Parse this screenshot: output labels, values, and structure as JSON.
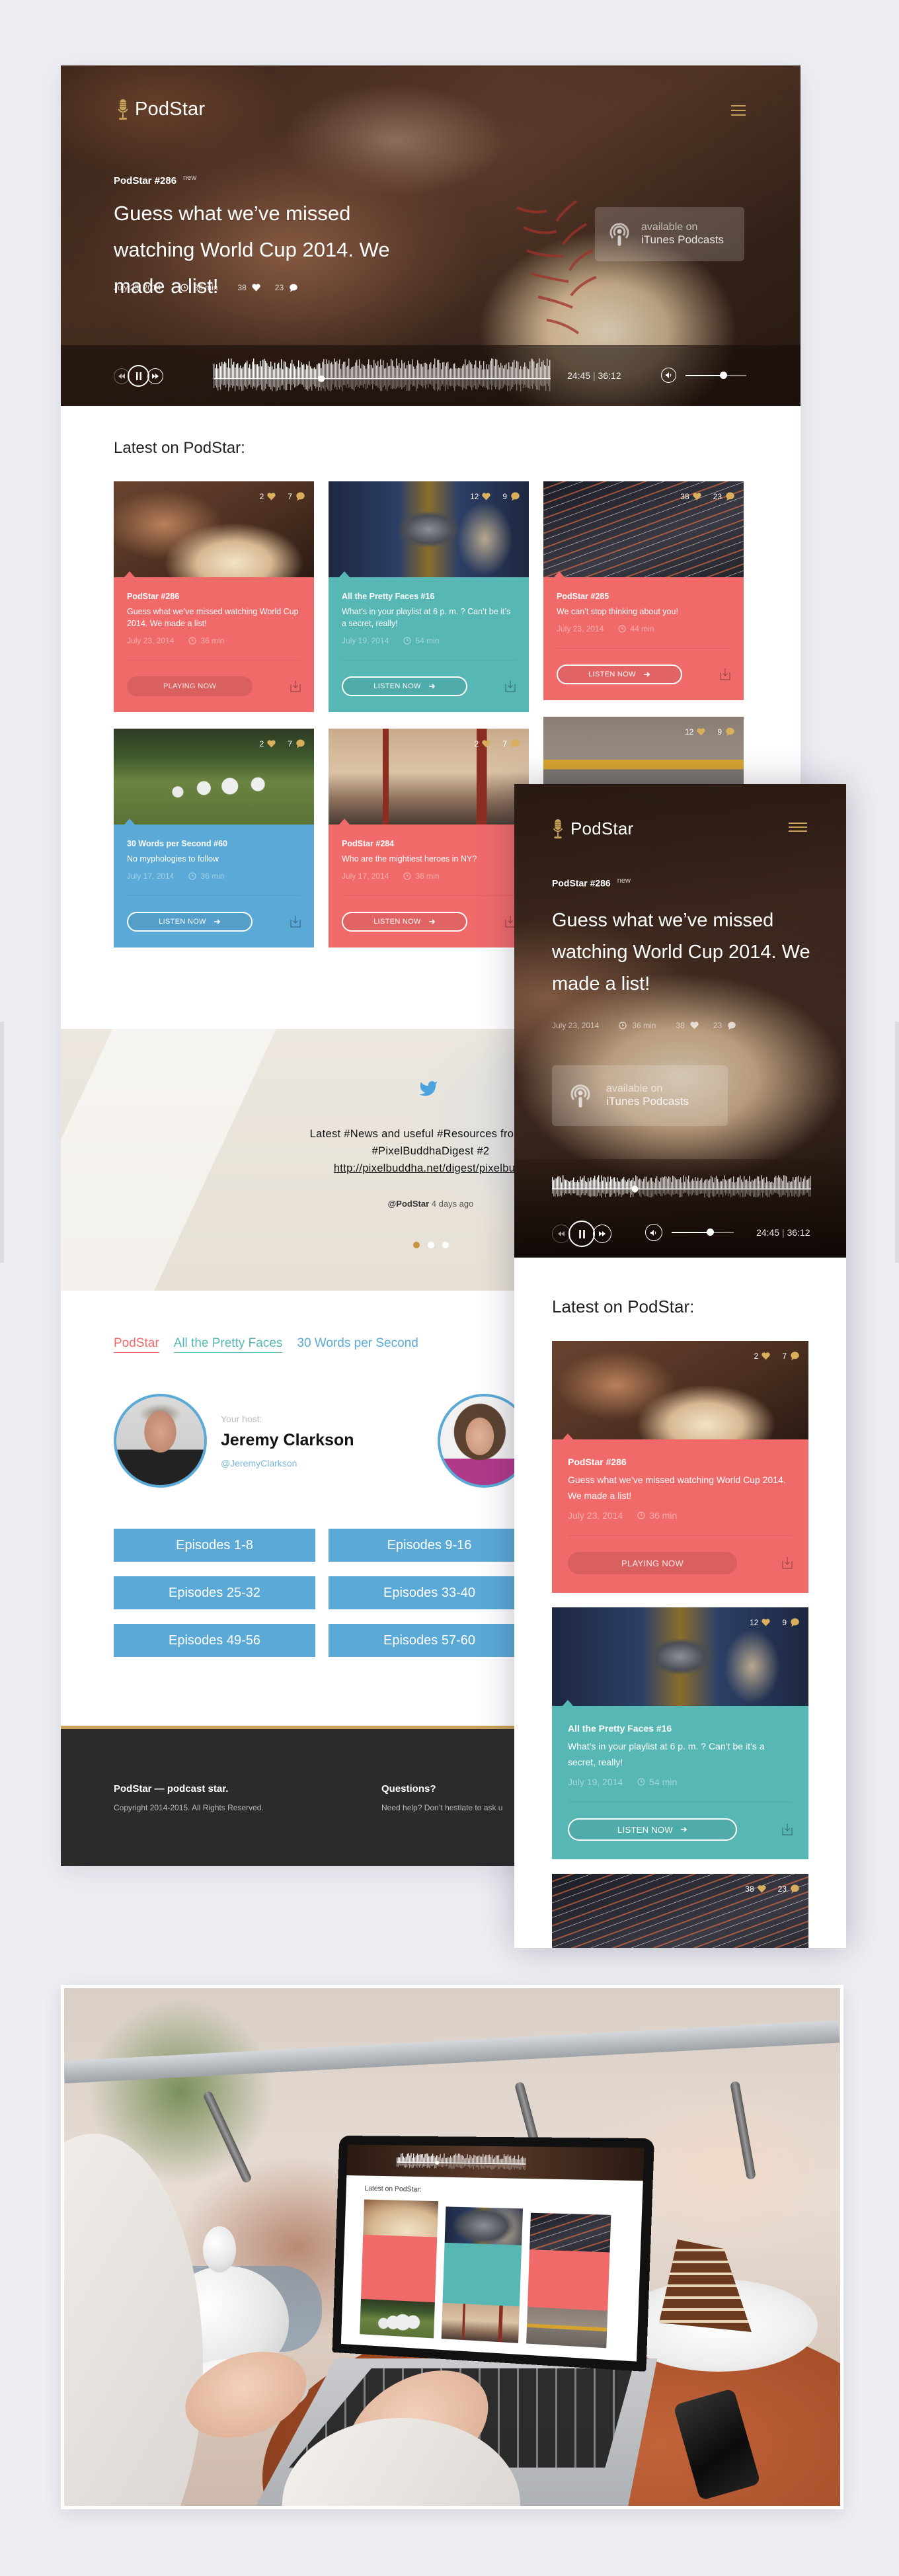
{
  "brand": {
    "name": "PodStar"
  },
  "hero": {
    "episode": "PodStar #286",
    "badge": "new",
    "title": "Guess what we’ve missed watching World Cup 2014. We made a list!",
    "date": "July 23, 2014",
    "duration": "36 min",
    "likes": "38",
    "comments": "23",
    "itunes": {
      "line1": "available on",
      "line2": "iTunes Podcasts"
    },
    "background_image": "baseball-in-glove"
  },
  "player": {
    "elapsed": "24:45",
    "separator": "|",
    "total": "36:12",
    "progress": 0.32,
    "volume": 0.62,
    "state": "playing"
  },
  "latest": {
    "heading": "Latest on PodStar:",
    "cards": [
      {
        "title": "PodStar #286",
        "description": "Guess what we’ve missed watching World Cup 2014. We made a list!",
        "date": "July 23, 2014",
        "duration": "36 min",
        "likes": "2",
        "comments": "7",
        "button": "PLAYING NOW",
        "state": "playing",
        "color": "#f06a6a",
        "image": "baseball"
      },
      {
        "title": "All the Pretty Faces #16",
        "description": "What’s in your playlist at 6 p. m. ? Can’t be it’s a secret, really!",
        "date": "July 19, 2014",
        "duration": "54 min",
        "likes": "12",
        "comments": "9",
        "button": "LISTEN NOW",
        "state": "idle",
        "color": "#56b7b5",
        "image": "camera"
      },
      {
        "title": "PodStar #285",
        "description": "We can’t stop thinking about you!",
        "date": "July 23, 2014",
        "duration": "44 min",
        "likes": "38",
        "comments": "23",
        "button": "LISTEN NOW",
        "state": "idle",
        "color": "#f06a6a",
        "image": "highway"
      },
      {
        "title": "30 Words per Second #60",
        "description": "No myphologies to follow",
        "date": "July 17, 2014",
        "duration": "36 min",
        "likes": "2",
        "comments": "7",
        "button": "LISTEN NOW",
        "state": "idle",
        "color": "#5aa9d6",
        "image": "sheep"
      },
      {
        "title": "PodStar #284",
        "description": "Who are the mightiest heroes in NY?",
        "date": "July 17, 2014",
        "duration": "36 min",
        "likes": "2",
        "comments": "7",
        "button": "LISTEN NOW",
        "state": "idle",
        "color": "#f06a6a",
        "image": "bridge"
      },
      {
        "likes": "12",
        "comments": "9",
        "color": "#56b7b5",
        "image": "subway"
      }
    ]
  },
  "tweet": {
    "line1": "Latest #News and useful #Resources from creat",
    "line2": "#PixelBuddhaDigest #2",
    "link": "http://pixelbuddha.net/digest/pixelbudd",
    "handle": "@PodStar",
    "time": "4 days ago",
    "slides": 3,
    "active_slide": 1
  },
  "shows": {
    "tabs": [
      {
        "label": "PodStar",
        "color": "#f06a6a",
        "active": true
      },
      {
        "label": "All the Pretty Faces",
        "color": "#56b7b5",
        "active": false
      },
      {
        "label": "30 Words per Second",
        "color": "#5aa9d6",
        "active": false
      }
    ]
  },
  "host": {
    "label": "Your host:",
    "name": "Jeremy Clarkson",
    "handle": "@JeremyClarkson"
  },
  "episodes": [
    "Episodes 1-8",
    "Episodes 9-16",
    "Episodes 25-32",
    "Episodes 33-40",
    "Episodes 49-56",
    "Episodes 57-60"
  ],
  "footer": {
    "brand_line": "PodStar — podcast star.",
    "copyright": "Copyright 2014-2015. All Rights Reserved.",
    "questions_title": "Questions?",
    "questions_text": "Need help?  Don’t hestiate to ask u"
  },
  "colors": {
    "coral": "#f06a6a",
    "teal": "#56b7b5",
    "blue": "#5aa9d6",
    "gold": "#c8a25a",
    "footer": "#2b2b2b",
    "page_bg": "#eeeff4"
  }
}
